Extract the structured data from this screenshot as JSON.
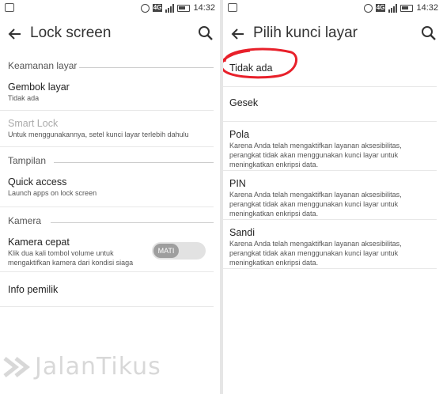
{
  "left": {
    "status": {
      "time": "14:32",
      "network": "4G"
    },
    "title": "Lock screen",
    "sections": [
      {
        "header": "Keamanan layar",
        "items": [
          {
            "title": "Gembok layar",
            "subtitle": "Tidak ada"
          },
          {
            "title": "Smart Lock",
            "subtitle": "Untuk menggunakannya, setel kunci layar terlebih dahulu"
          }
        ]
      },
      {
        "header": "Tampilan",
        "items": [
          {
            "title": "Quick access",
            "subtitle": "Launch apps on lock screen"
          }
        ]
      },
      {
        "header": "Kamera",
        "items": [
          {
            "title": "Kamera cepat",
            "subtitle_1": "Klik dua kali tombol volume untuk",
            "subtitle_2": "mengaktifkan kamera dari kondisi siaga",
            "toggle": "MATI"
          },
          {
            "title": "Info pemilik"
          }
        ]
      }
    ]
  },
  "right": {
    "status": {
      "time": "14:32",
      "network": "4G"
    },
    "title": "Pilih kunci layar",
    "options": [
      {
        "title": "Tidak ada"
      },
      {
        "title": "Gesek"
      },
      {
        "title": "Pola",
        "desc_1": "Karena Anda telah mengaktifkan layanan aksesibilitas,",
        "desc_2": "perangkat tidak akan menggunakan kunci layar untuk",
        "desc_3": "meningkatkan enkripsi data."
      },
      {
        "title": "PIN",
        "desc_1": "Karena Anda telah mengaktifkan layanan aksesibilitas,",
        "desc_2": "perangkat tidak akan menggunakan kunci layar untuk",
        "desc_3": "meningkatkan enkripsi data."
      },
      {
        "title": "Sandi",
        "desc_1": "Karena Anda telah mengaktifkan layanan aksesibilitas,",
        "desc_2": "perangkat tidak akan menggunakan kunci layar untuk",
        "desc_3": "meningkatkan enkripsi data."
      }
    ]
  },
  "watermark": "JalanTikus",
  "colors": {
    "annotation": "#e8202a",
    "divider": "#e6e6e6",
    "toggle_off": "#9e9e9e"
  },
  "icons": [
    "back-arrow-icon",
    "search-icon",
    "alarm-icon",
    "signal-icon",
    "battery-icon"
  ]
}
